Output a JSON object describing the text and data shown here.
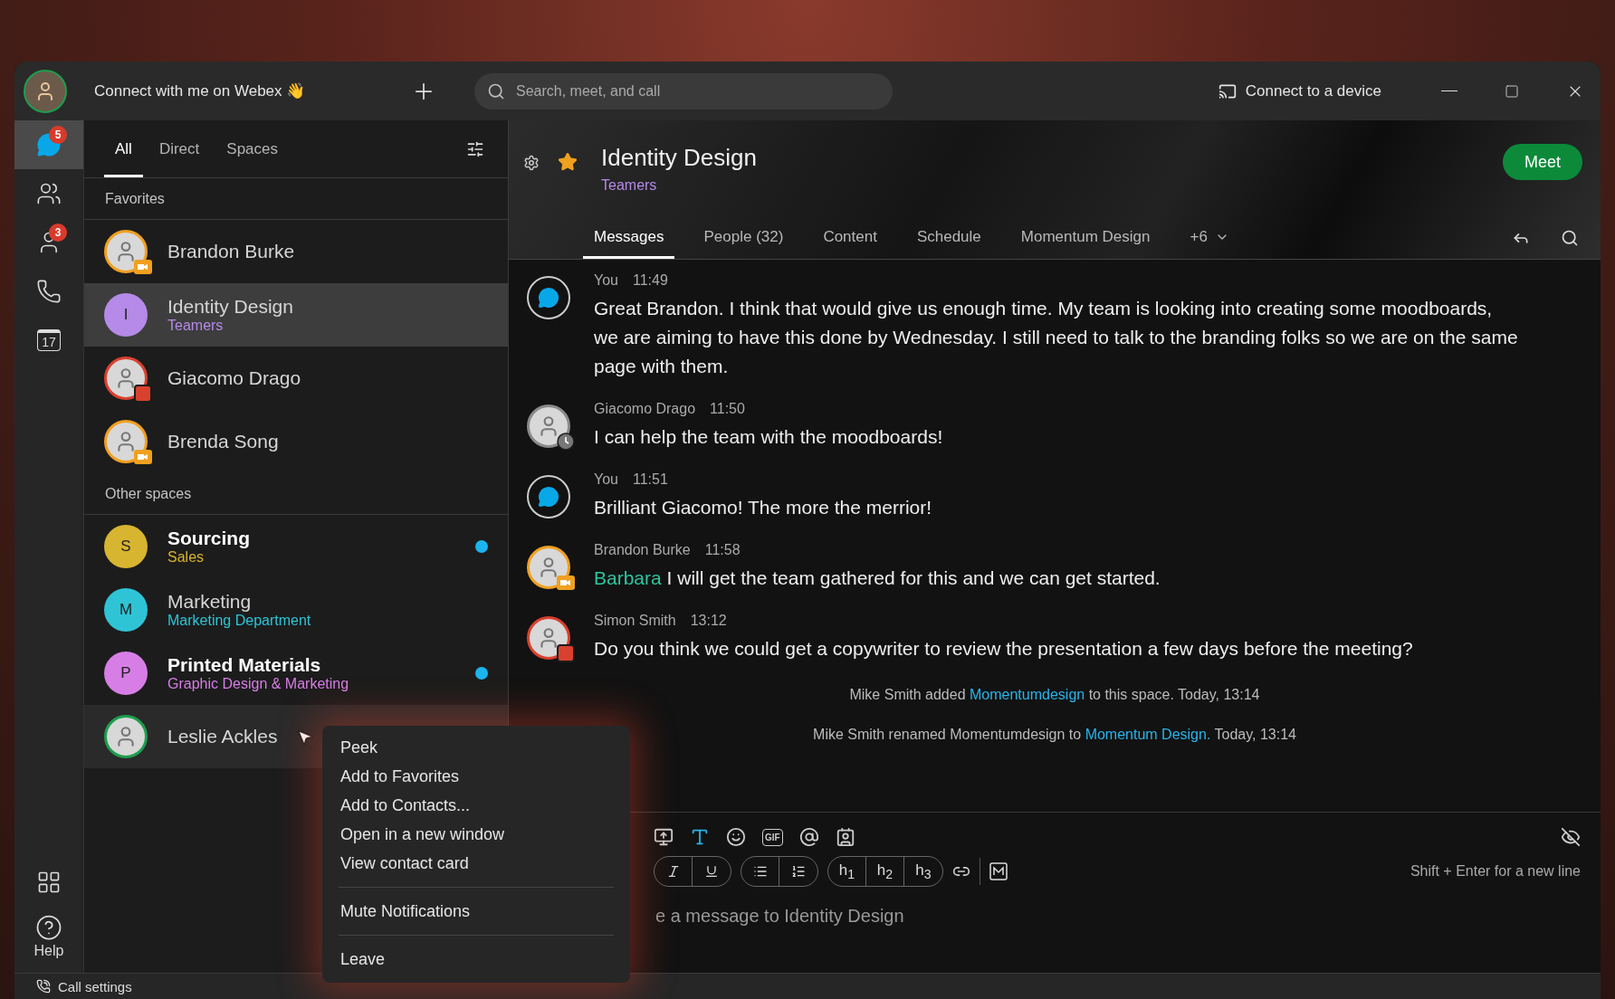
{
  "titlebar": {
    "status": "Connect with me on Webex 👋",
    "search": {
      "placeholder": "Search, meet, and call"
    },
    "device": "Connect to a device"
  },
  "nav": {
    "items": [
      {
        "kind": "messaging",
        "badge": "5",
        "selected": true
      },
      {
        "kind": "teams",
        "selected": false
      },
      {
        "kind": "contacts",
        "badge": "3",
        "selected": false
      },
      {
        "kind": "calling",
        "selected": false
      },
      {
        "kind": "calendar",
        "label": "17",
        "selected": false
      }
    ],
    "help": "Help"
  },
  "list": {
    "tabs": [
      {
        "label": "All",
        "selected": true
      },
      {
        "label": "Direct",
        "selected": false
      },
      {
        "label": "Spaces",
        "selected": false
      }
    ],
    "sections": [
      {
        "title": "Favorites",
        "items": [
          {
            "kind": "person",
            "name": "Brandon Burke",
            "color": "#f0a020",
            "presence": {
              "kind": "video"
            },
            "selected": false,
            "hovered": false
          },
          {
            "kind": "space",
            "name": "Identity Design",
            "initial": "I",
            "subtitle": "Teamers",
            "color": "#b58ae8",
            "unread": false,
            "selected": true,
            "hovered": false
          },
          {
            "kind": "person",
            "name": "Giacomo Drago",
            "color": "#d9412f",
            "presence": {
              "kind": "share"
            },
            "selected": false,
            "hovered": false
          },
          {
            "kind": "person",
            "name": "Brenda Song",
            "color": "#f0a020",
            "presence": {
              "kind": "video"
            },
            "selected": false,
            "hovered": false
          }
        ]
      },
      {
        "title": "Other spaces",
        "items": [
          {
            "kind": "space",
            "name": "Sourcing",
            "initial": "S",
            "subtitle": "Sales",
            "color": "#d8b530",
            "unread": true,
            "selected": false,
            "hovered": false
          },
          {
            "kind": "space",
            "name": "Marketing",
            "initial": "M",
            "subtitle": "Marketing Department",
            "color": "#2ec4d6",
            "unread": false,
            "selected": false,
            "hovered": false
          },
          {
            "kind": "space",
            "name": "Printed Materials",
            "initial": "P",
            "subtitle": "Graphic Design & Marketing",
            "color": "#d77ee6",
            "unread": true,
            "selected": false,
            "hovered": false
          },
          {
            "kind": "person",
            "name": "Leslie Ackles",
            "color": "#1e9e4e",
            "selected": false,
            "hovered": true
          }
        ]
      }
    ]
  },
  "chat": {
    "title": "Identity Design",
    "subtitle": "Teamers",
    "favorite": true,
    "meet": "Meet",
    "tabs": [
      {
        "label": "Messages",
        "selected": true
      },
      {
        "label": "People (32)",
        "selected": false
      },
      {
        "label": "Content",
        "selected": false
      },
      {
        "label": "Schedule",
        "selected": false
      },
      {
        "label": "Momentum Design",
        "selected": false
      },
      {
        "label": "+6",
        "selected": false
      }
    ],
    "messages": [
      {
        "kind": "self",
        "author": "You",
        "time": "11:49",
        "text": "Great Brandon. I think that would give us enough time. My team is looking into creating some moodboards, we are aiming to have this done by Wednesday. I still need to talk to the branding folks so we are on the same page with them."
      },
      {
        "kind": "person",
        "author": "Giacomo Drago",
        "time": "11:50",
        "color": "#8a8a8a",
        "presence": {
          "kind": "away"
        },
        "text": "I can help the team with the moodboards!"
      },
      {
        "kind": "self",
        "author": "You",
        "time": "11:51",
        "text": "Brilliant Giacomo! The more the merrior!"
      },
      {
        "kind": "person",
        "author": "Brandon Burke",
        "time": "11:58",
        "color": "#f0a020",
        "presence": {
          "kind": "video"
        },
        "mention": "Barbara",
        "text": "I will get the team gathered for this and we can get started."
      },
      {
        "kind": "person",
        "author": "Simon Smith",
        "time": "13:12",
        "color": "#d9412f",
        "presence": {
          "kind": "share"
        },
        "text": "Do you think we could get a copywriter to review the presentation a few days before the meeting?"
      }
    ],
    "events": [
      {
        "before": "Mike Smith added",
        "link": "Momentumdesign",
        "after": "to this space. Today, 13:14"
      },
      {
        "before": "Mike Smith renamed Momentumdesign to",
        "link": "Momentum Design.",
        "after": "Today, 13:14"
      }
    ],
    "composer": {
      "gif": "GIF",
      "headings": [
        "h$_{1}$",
        "h$_{2}$",
        "h$_{3}$"
      ],
      "hint": "Shift + Enter for a new line",
      "placeholder": "e a message to Identity Design"
    }
  },
  "menu": {
    "groups": [
      [
        "Peek",
        "Add to Favorites",
        "Add to Contacts...",
        "Open in a new window",
        "View contact card"
      ],
      [
        "Mute Notifications"
      ],
      [
        "Leave"
      ]
    ]
  },
  "footer": {
    "call_settings": "Call settings"
  }
}
